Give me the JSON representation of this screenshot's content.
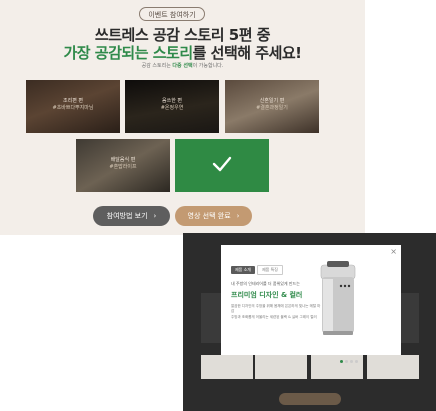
{
  "event": {
    "tag": "이벤트 참여하기",
    "title_line1": "쓰트레스 공감 스토리 5편 중",
    "title_line2_highlight": "가장 공감되는 스토리",
    "title_line2_rest": "를 선택해 주세요!",
    "hint_prefix": "공감 스토리는 ",
    "hint_bold": "다중 선택",
    "hint_suffix": "이 가능합니다."
  },
  "stories": [
    {
      "title": "조리편 편",
      "tag": "#초바쁘다뿌지마님"
    },
    {
      "title": "음쓰한 편",
      "tag": "#온정우연"
    },
    {
      "title": "신혼일기 편",
      "tag": "#결혼과정일기"
    },
    {
      "title": "배달음식 편",
      "tag": "#혼밥라이프"
    },
    {
      "title": "",
      "tag": "",
      "selected": true
    }
  ],
  "buttons": {
    "guide": "참여방법 보기",
    "done": "영상 선택 완료",
    "arrow": "›"
  },
  "modal": {
    "close": "×",
    "tab_active": "제품 소개",
    "tab_inactive": "제품 특징",
    "sub": "내 주방의 인테리어를 더 품위있게 만드는",
    "headline": "프리미엄 디자인 & 컬러",
    "body1": "깔끔한 디자인의 주방을 위해 몸체에 은은하게 빛나는 메탈 마감",
    "body2": "주방과 조화롭게 어울리는 세련된 블랙 & 실버 그레이 컬러",
    "dots_total": 4,
    "dot_active": 0
  },
  "colors": {
    "accent_green": "#2f8a4a",
    "button_gray": "#5e5e5e",
    "button_tan": "#c39a72",
    "panel_bg": "#f3eee9"
  }
}
